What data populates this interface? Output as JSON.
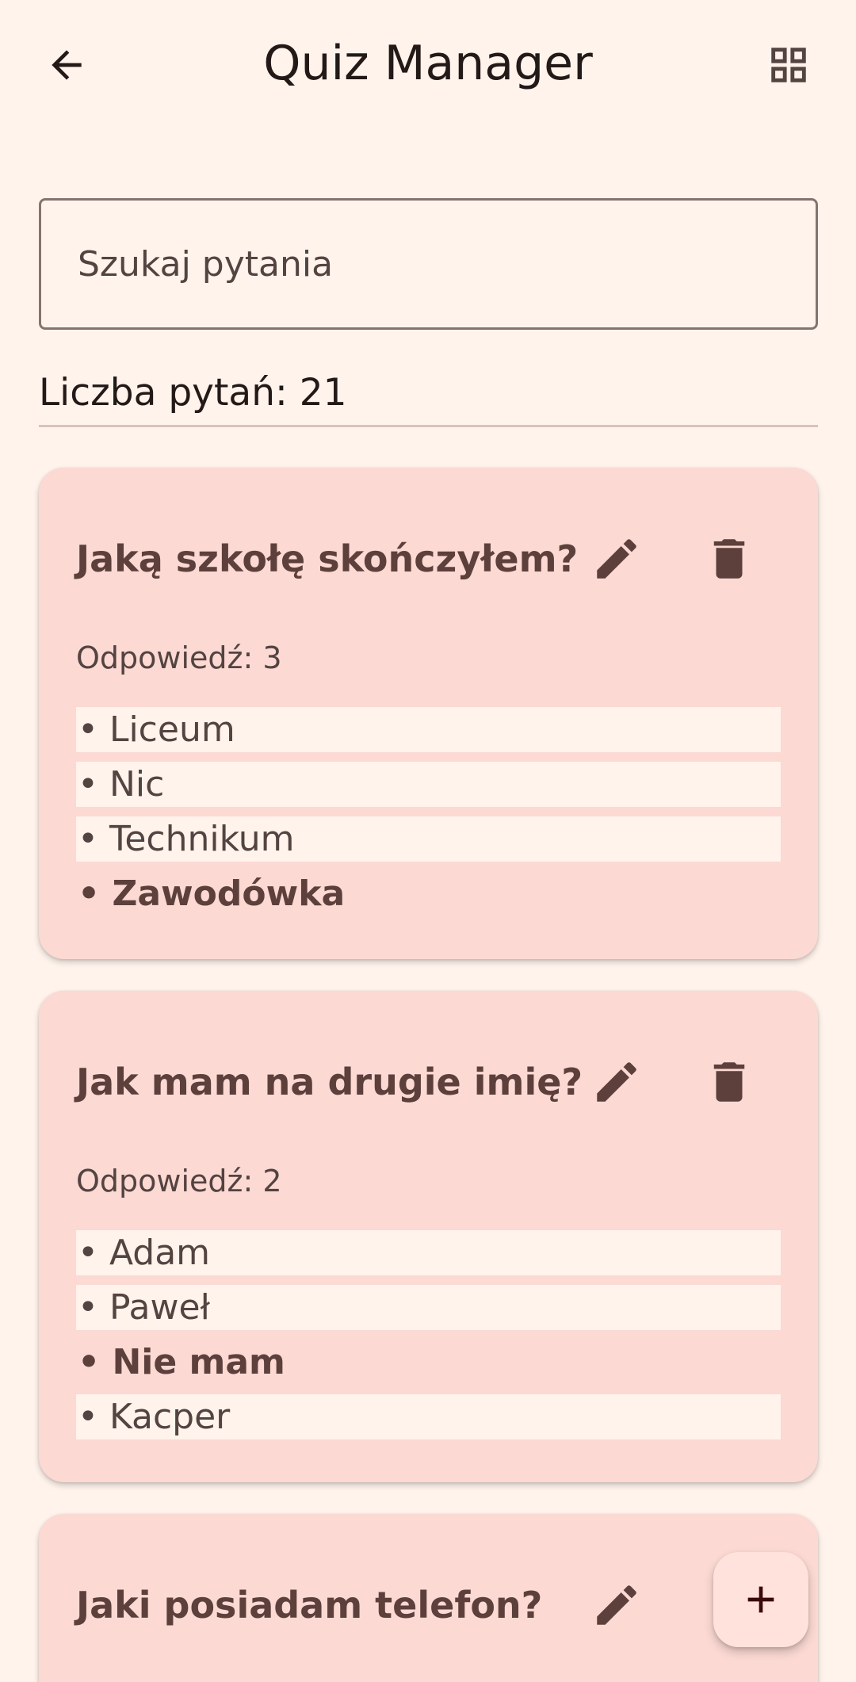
{
  "header": {
    "title": "Quiz Manager",
    "back_icon": "arrow-back-icon",
    "view_icon": "grid-view-icon"
  },
  "search": {
    "placeholder": "Szukaj pytania",
    "value": ""
  },
  "question_count_text": "Liczba pytań: 21",
  "questions": [
    {
      "title": "Jaką szkołę skończyłem?",
      "answer_text": "Odpowiedź: 3",
      "options": [
        {
          "text": "• Liceum",
          "correct": false
        },
        {
          "text": "• Nic",
          "correct": false
        },
        {
          "text": "• Technikum",
          "correct": false
        },
        {
          "text": "• Zawodówka",
          "correct": true
        }
      ]
    },
    {
      "title": "Jak mam na drugie imię?",
      "answer_text": "Odpowiedź: 2",
      "options": [
        {
          "text": "• Adam",
          "correct": false
        },
        {
          "text": "• Paweł",
          "correct": false
        },
        {
          "text": "• Nie mam",
          "correct": true
        },
        {
          "text": "• Kacper",
          "correct": false
        }
      ]
    },
    {
      "title": "Jaki posiadam telefon?"
    }
  ],
  "fab": {
    "icon": "add-icon"
  },
  "colors": {
    "background": "#FFF3EC",
    "card": "#FCD9D3",
    "on_card": "#5D403C",
    "icon": "#5D403C",
    "outline": "#857370",
    "fab": "#FFE2DC"
  }
}
